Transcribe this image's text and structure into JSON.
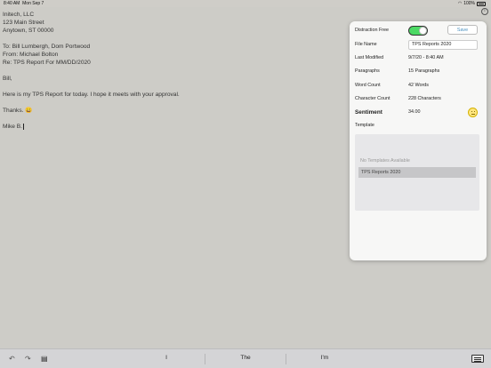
{
  "status_bar": {
    "time": "8:40 AM",
    "date": "Mon Sep 7",
    "battery": "100%"
  },
  "document": {
    "lines": [
      "Initech, LLC",
      "123 Main Street",
      "Anytown, ST 00000",
      "",
      "To: Bill Lumbergh, Dom Portwood",
      "From: Michael Bolton",
      "Re: TPS Report For MM/DD/2020",
      "",
      "Bill,",
      "",
      "Here is my TPS Report for today. I hope it meets with your approval.",
      "",
      "Thanks. 😀",
      "",
      "Mike B."
    ]
  },
  "info_panel": {
    "distraction_free_label": "Distraction Free",
    "distraction_free_on": true,
    "save_label": "Save",
    "file_name_label": "File Name",
    "file_name_value": "TPS Reports 2020",
    "last_modified_label": "Last Modified",
    "last_modified_value": "9/7/20 - 8:40 AM",
    "paragraphs_label": "Paragraphs",
    "paragraphs_value": "15 Paragraphs",
    "word_count_label": "Word Count",
    "word_count_value": "42 Words",
    "character_count_label": "Character Count",
    "character_count_value": "228 Characters",
    "sentiment_label": "Sentiment",
    "sentiment_value": "34.00",
    "sentiment_icon": "neutral-face-icon",
    "template_label": "Template",
    "no_templates_text": "No Templates Available",
    "templates": [
      "TPS Reports 2020"
    ]
  },
  "keyboard_bar": {
    "suggestions": [
      "I",
      "The",
      "I'm"
    ],
    "icons": [
      "undo-icon",
      "redo-icon",
      "paste-icon",
      "keyboard-icon"
    ]
  },
  "colors": {
    "toggle_on": "#4cd964",
    "accent": "#4a90c0",
    "background": "#cdccc7"
  }
}
